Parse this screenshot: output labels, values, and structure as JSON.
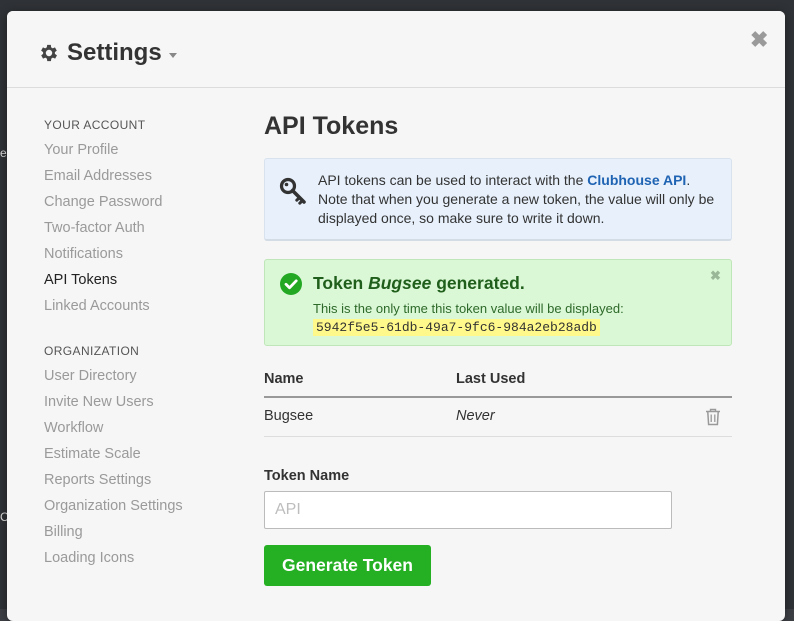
{
  "background": {
    "edge_glyphs": [
      "e",
      "C"
    ]
  },
  "header": {
    "title": "Settings",
    "close_label": "✖"
  },
  "sidebar": {
    "your_account_heading": "YOUR ACCOUNT",
    "your_account_items": [
      {
        "label": "Your Profile"
      },
      {
        "label": "Email Addresses"
      },
      {
        "label": "Change Password"
      },
      {
        "label": "Two-factor Auth"
      },
      {
        "label": "Notifications"
      },
      {
        "label": "API Tokens",
        "active": true
      },
      {
        "label": "Linked Accounts"
      }
    ],
    "organization_heading": "ORGANIZATION",
    "organization_items": [
      {
        "label": "User Directory"
      },
      {
        "label": "Invite New Users"
      },
      {
        "label": "Workflow"
      },
      {
        "label": "Estimate Scale"
      },
      {
        "label": "Reports Settings"
      },
      {
        "label": "Organization Settings"
      },
      {
        "label": "Billing"
      },
      {
        "label": "Loading Icons"
      }
    ]
  },
  "main": {
    "title": "API Tokens",
    "info": {
      "text_before": "API tokens can be used to interact with the ",
      "link": "Clubhouse API",
      "text_after": ". Note that when you generate a new token, the value will only be displayed once, so make sure to write it down."
    },
    "success": {
      "title_prefix": "Token ",
      "token_name": "Bugsee",
      "title_suffix": " generated.",
      "subtitle": "This is the only time this token value will be displayed:",
      "token_value": "5942f5e5-61db-49a7-9fc6-984a2eb28adb",
      "close_label": "✖"
    },
    "table": {
      "headers": {
        "name": "Name",
        "last_used": "Last Used"
      },
      "rows": [
        {
          "name": "Bugsee",
          "last_used": "Never"
        }
      ]
    },
    "form": {
      "label": "Token Name",
      "placeholder": "API",
      "value": "",
      "button_label": "Generate Token"
    }
  },
  "colors": {
    "accent_link": "#1f63b3",
    "button_green": "#24b022",
    "success_bg": "#daf7d6",
    "info_bg": "#e7f0fb",
    "token_highlight": "#fff88a"
  }
}
